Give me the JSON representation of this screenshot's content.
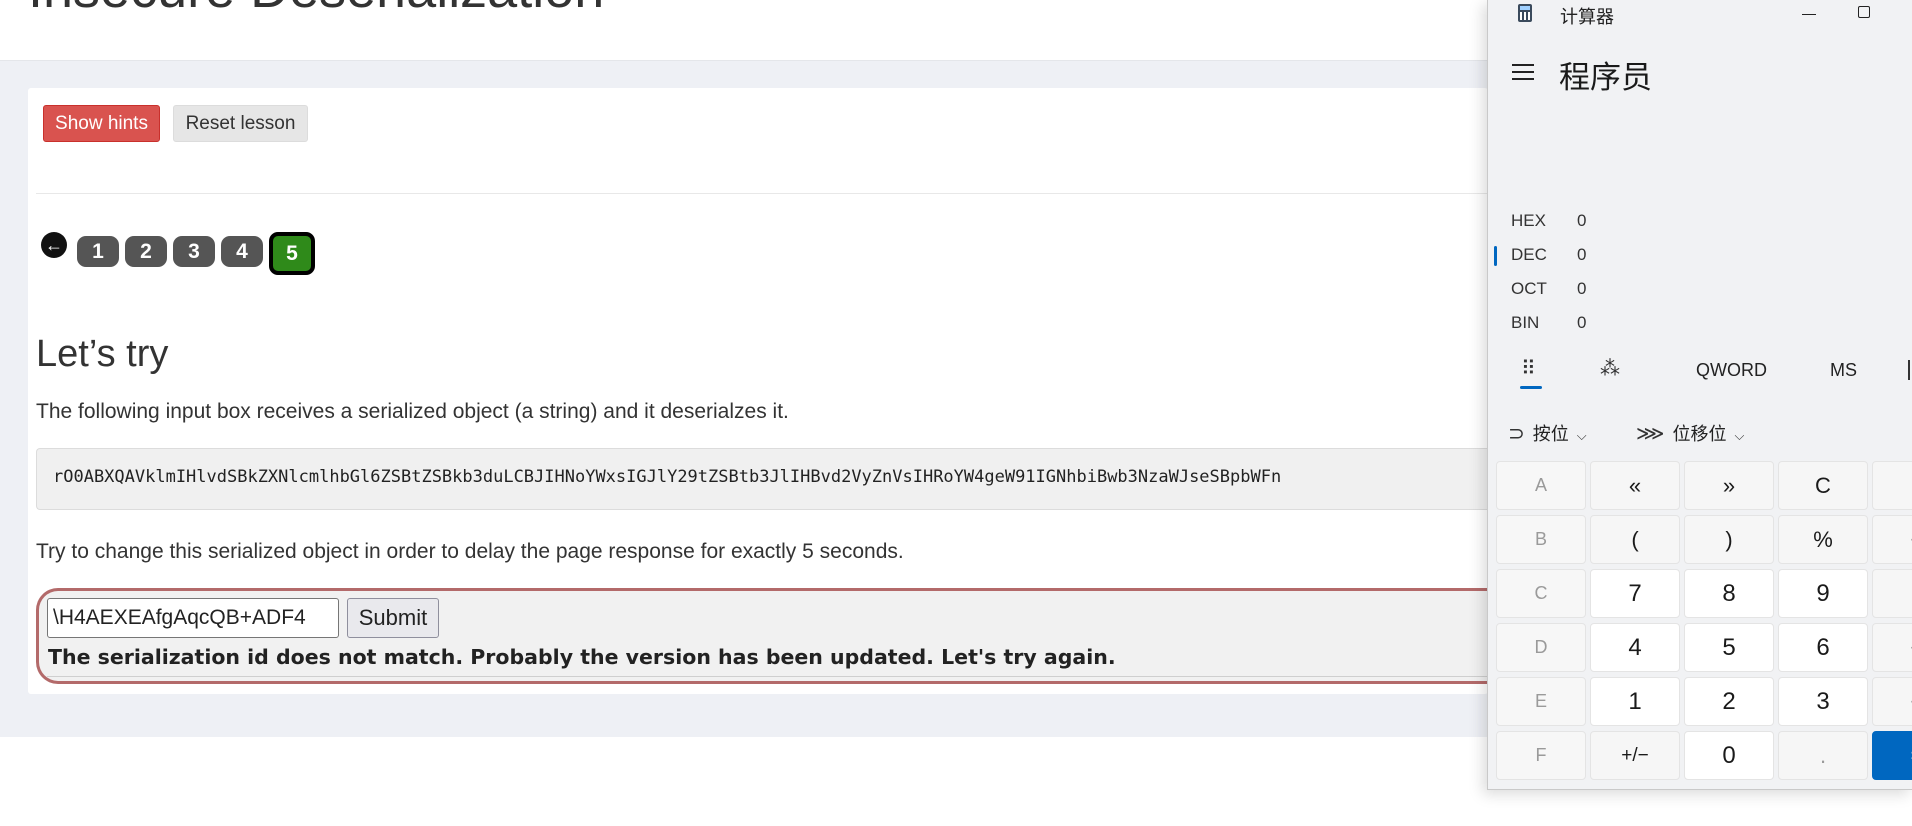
{
  "page": {
    "title": "Insecure Deserialization",
    "buttons": {
      "show_hints": "Show hints",
      "reset_lesson": "Reset lesson"
    },
    "pagination": {
      "pages": [
        "1",
        "2",
        "3",
        "4",
        "5"
      ],
      "active": "5"
    },
    "section_title": "Let’s try",
    "description": "The following input box receives a serialized object (a string) and it deserialzes it.",
    "serialized_object": "rO0ABXQAVklmIHlvdSBkZXNlcmlhbGl6ZSBtZSBkb3duLCBJIHNoYWxsIGJlY29tZSBtb3JlIHBvd2VyZnVsIHRoYW4geW91IGNhbiBwb3NzaWJseSBpbWFn",
    "instruction": "Try to change this serialized object in order to delay the page response for exactly 5 seconds.",
    "attack_input_value": "\\H4AEXEAfgAqcQB+ADF4",
    "submit_label": "Submit",
    "feedback": "The serialization id does not match. Probably the version has been updated. Let's try again."
  },
  "calculator": {
    "window_title": "计算器",
    "mode": "程序员",
    "radix": [
      {
        "label": "HEX",
        "value": "0"
      },
      {
        "label": "DEC",
        "value": "0"
      },
      {
        "label": "OCT",
        "value": "0"
      },
      {
        "label": "BIN",
        "value": "0"
      }
    ],
    "active_radix": "DEC",
    "word_size": "QWORD",
    "memory_label": "MS",
    "bitwise_menu": "按位",
    "bitshift_menu": "位移位",
    "keys": {
      "hexA": "A",
      "hexB": "B",
      "hexC": "C",
      "hexD": "D",
      "hexE": "E",
      "hexF": "F",
      "lshift": "«",
      "rshift": "»",
      "clear": "C",
      "backspace": "‹",
      "lparen": "(",
      "rparen": ")",
      "mod": "%",
      "divide": "÷",
      "seven": "7",
      "eight": "8",
      "nine": "9",
      "multiply": "×",
      "four": "4",
      "five": "5",
      "six": "6",
      "minus": "−",
      "one": "1",
      "two": "2",
      "three": "3",
      "plus": "+",
      "negate": "+/−",
      "zero": "0",
      "decimal": ".",
      "equals": "="
    }
  }
}
